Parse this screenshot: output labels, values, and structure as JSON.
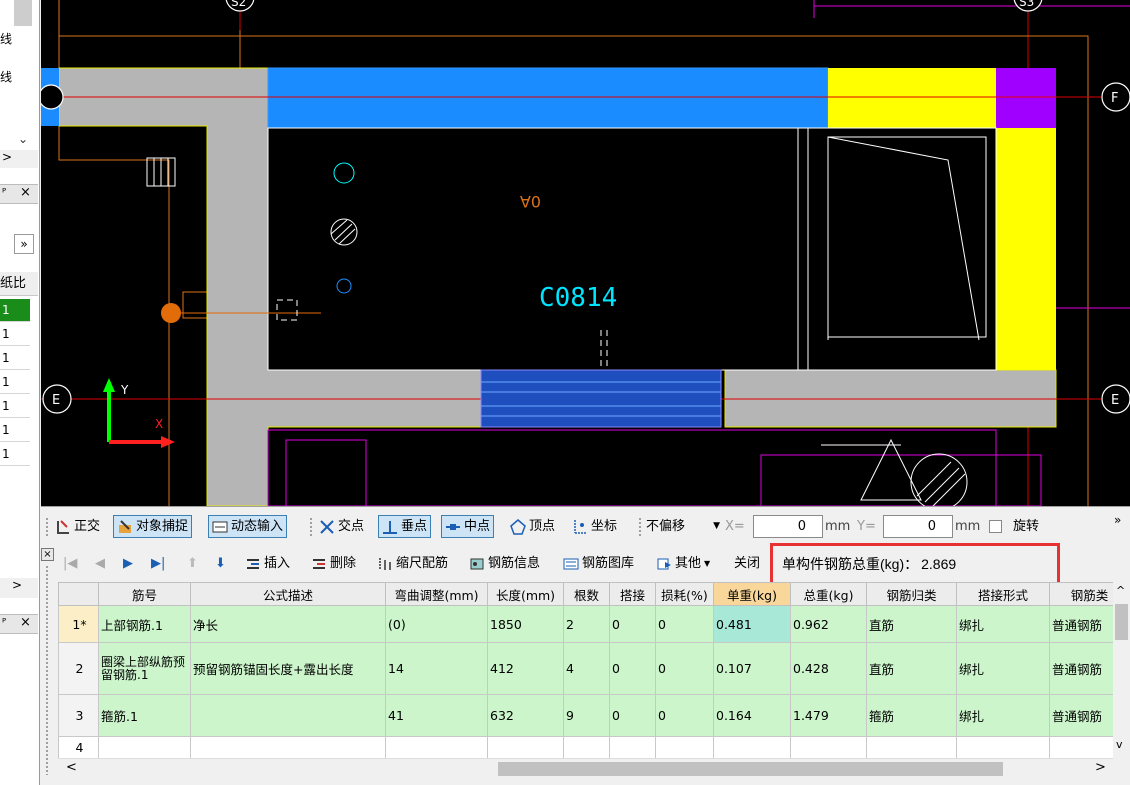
{
  "left_panel": {
    "frag_top": [
      "线",
      "线"
    ],
    "pin_glyph": "ᴾ",
    "close_glyph": "×",
    "more_glyph": "»",
    "col_header": "纸比",
    "values": [
      "1",
      "1",
      "1",
      "1",
      "1",
      "1",
      "1"
    ],
    "arrow_right": ">",
    "arrow_down": "⌄"
  },
  "cad": {
    "axis_labels": {
      "s2": "S2",
      "s3": "S3",
      "f": "F",
      "e": "E"
    },
    "window_label": "C0814",
    "hatch_label": "0A",
    "ucs_x": "X",
    "ucs_y": "Y"
  },
  "snap_toolbar": {
    "ortho": "正交",
    "object_snap": "对象捕捉",
    "dynamic_input": "动态输入",
    "intersection": "交点",
    "perpendicular": "垂点",
    "midpoint": "中点",
    "vertex": "顶点",
    "coordinate": "坐标",
    "offset_select": "不偏移",
    "x_label": "X=",
    "x_value": "0",
    "x_unit": "mm",
    "y_label": "Y=",
    "y_value": "0",
    "y_unit": "mm",
    "rotate": "旋转",
    "more": "»"
  },
  "rebar_toolbar": {
    "insert": "插入",
    "delete": "删除",
    "scale_rebar": "缩尺配筋",
    "rebar_info": "钢筋信息",
    "rebar_library": "钢筋图库",
    "other": "其他",
    "close": "关闭",
    "total_weight_label": "单构件钢筋总重(kg)：",
    "total_weight_value": "2.869"
  },
  "table": {
    "headers": [
      "",
      "筋号",
      "公式描述",
      "弯曲调整(mm)",
      "长度(mm)",
      "根数",
      "搭接",
      "损耗(%)",
      "单重(kg)",
      "总重(kg)",
      "钢筋归类",
      "搭接形式",
      "钢筋类"
    ],
    "rows": [
      {
        "num": "1*",
        "name": "上部钢筋.1",
        "formula": "净长",
        "bend": "(0)",
        "length": "1850",
        "count": "2",
        "lap": "0",
        "loss": "0",
        "unit_weight": "0.481",
        "total_weight": "0.962",
        "category": "直筋",
        "lap_type": "绑扎",
        "rebar_type": "普通钢筋"
      },
      {
        "num": "2",
        "name": "圈梁上部纵筋预留钢筋.1",
        "formula": "预留钢筋锚固长度+露出长度",
        "bend": "14",
        "length": "412",
        "count": "4",
        "lap": "0",
        "loss": "0",
        "unit_weight": "0.107",
        "total_weight": "0.428",
        "category": "直筋",
        "lap_type": "绑扎",
        "rebar_type": "普通钢筋"
      },
      {
        "num": "3",
        "name": "箍筋.1",
        "formula": "",
        "bend": "41",
        "length": "632",
        "count": "9",
        "lap": "0",
        "loss": "0",
        "unit_weight": "0.164",
        "total_weight": "1.479",
        "category": "箍筋",
        "lap_type": "绑扎",
        "rebar_type": "普通钢筋"
      },
      {
        "num": "4",
        "name": "",
        "formula": "",
        "bend": "",
        "length": "",
        "count": "",
        "lap": "",
        "loss": "",
        "unit_weight": "",
        "total_weight": "",
        "category": "",
        "lap_type": "",
        "rebar_type": ""
      }
    ]
  },
  "scroll": {
    "left": "<",
    "right": ">",
    "up": "^",
    "down": "v"
  }
}
